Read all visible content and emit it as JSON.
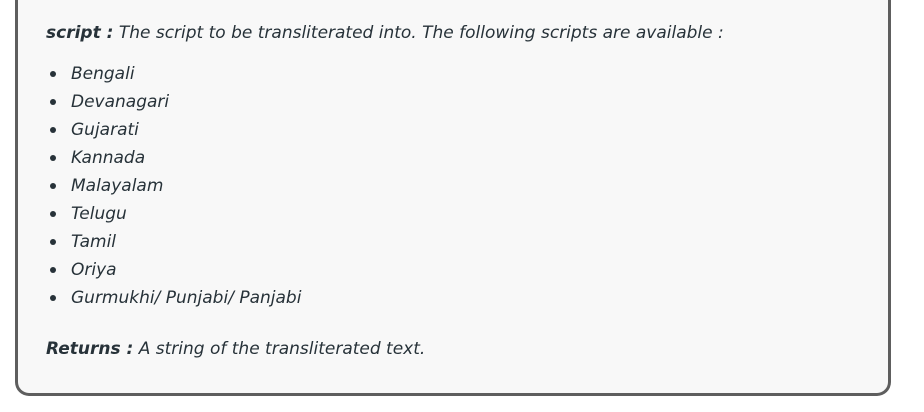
{
  "params": {
    "script_label": "script :",
    "script_desc": " The script to be transliterated into. The following scripts are available :"
  },
  "scripts": [
    "Bengali",
    "Devanagari",
    "Gujarati",
    "Kannada",
    "Malayalam",
    "Telugu",
    "Tamil",
    "Oriya",
    "Gurmukhi/ Punjabi/ Panjabi"
  ],
  "returns": {
    "label": "Returns :",
    "desc": " A string of the transliterated text."
  },
  "colors": {
    "box_background": "#f8f8f8",
    "border": "#5e5e5e",
    "text": "#273239"
  }
}
